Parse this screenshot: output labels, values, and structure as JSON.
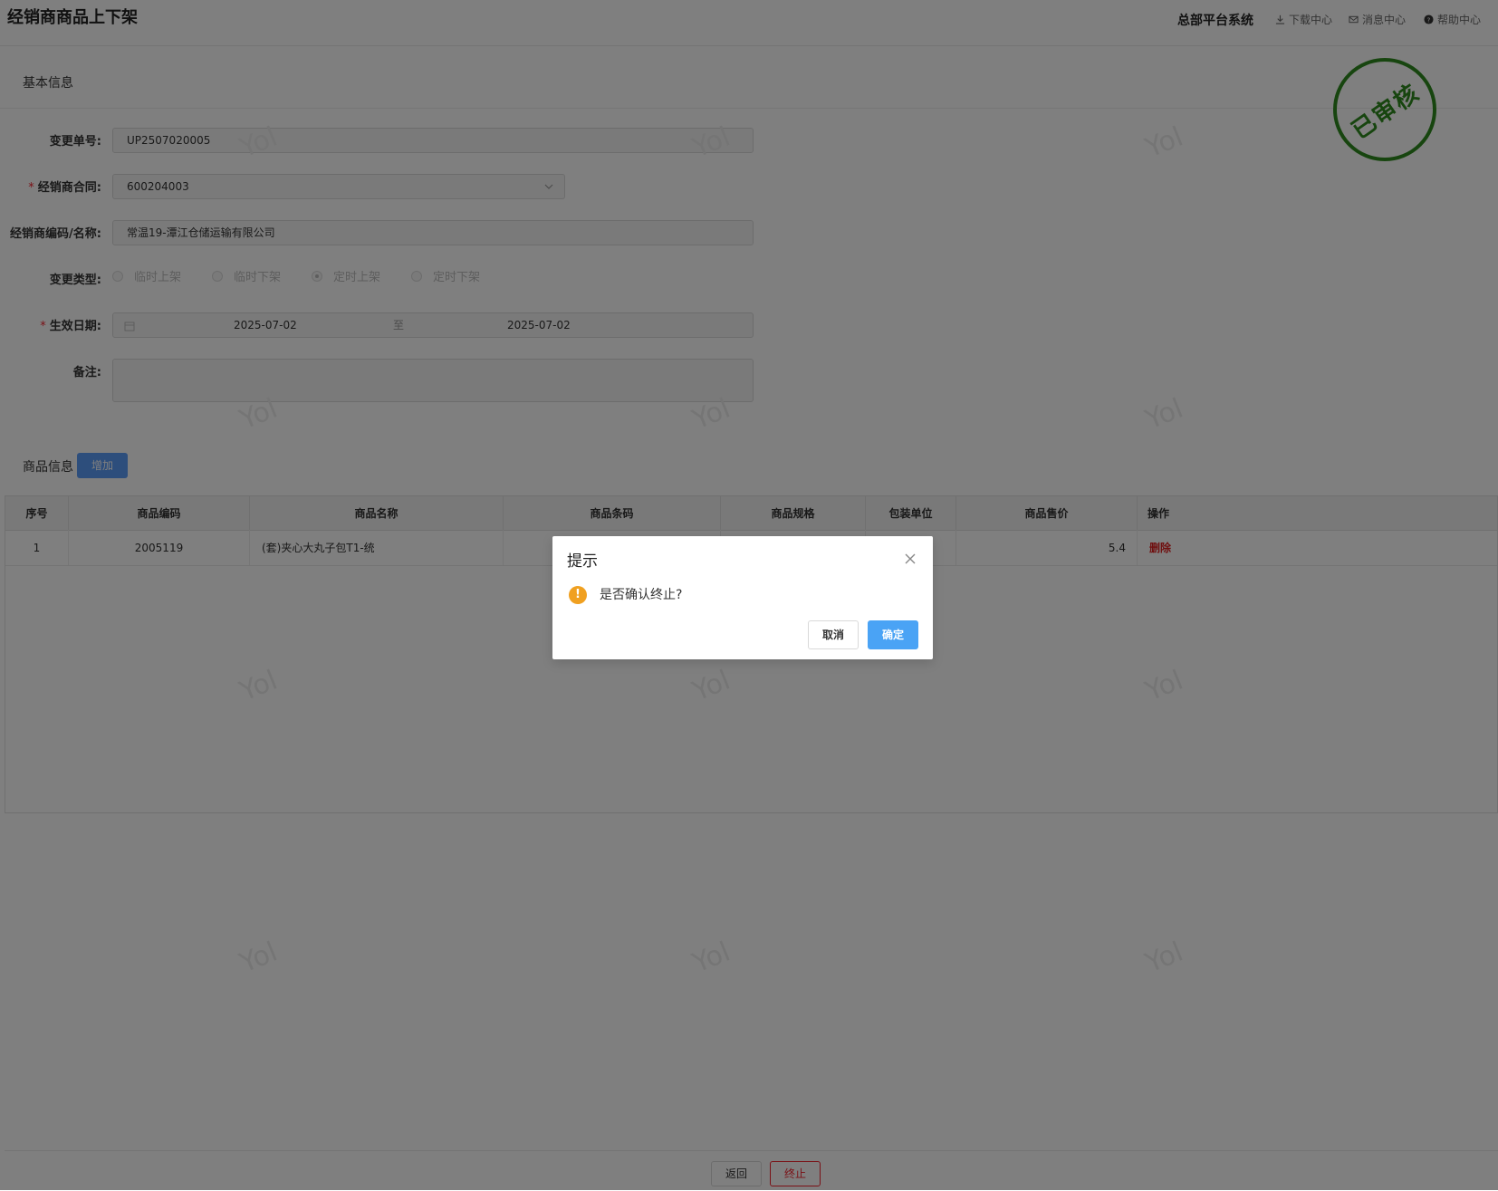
{
  "header": {
    "title": "经销商商品上下架",
    "system_name": "总部平台系统",
    "links": [
      "下载中心",
      "消息中心",
      "帮助中心"
    ]
  },
  "basic": {
    "section_title": "基本信息",
    "stamp": "已审核",
    "change_no_label": "变更单号:",
    "change_no": "UP2507020005",
    "contract_label": "经销商合同:",
    "contract": "600204003",
    "dealer_label": "经销商编码/名称:",
    "dealer": "常温19-潭江仓储运输有限公司",
    "type_label": "变更类型:",
    "type_options": [
      "临时上架",
      "临时下架",
      "定时上架",
      "定时下架"
    ],
    "type_selected": "定时上架",
    "date_label": "生效日期:",
    "date_start": "2025-07-02",
    "date_sep": "至",
    "date_end": "2025-07-02",
    "remark_label": "备注:",
    "remark": ""
  },
  "goods": {
    "section_title": "商品信息",
    "add_label": "增加",
    "columns": [
      "序号",
      "商品编码",
      "商品名称",
      "商品条码",
      "商品规格",
      "包装单位",
      "商品售价",
      "操作"
    ],
    "rows": [
      {
        "idx": "1",
        "code": "2005119",
        "name": "(套)夹心大丸子包T1-统",
        "barcode": "",
        "spec": "",
        "unit": "",
        "price": "5.4",
        "action": "删除"
      }
    ]
  },
  "watermark": "Yol",
  "footer": {
    "back_label": "返回",
    "stop_label": "终止"
  },
  "dialog": {
    "title": "提示",
    "message": "是否确认终止?",
    "warn_symbol": "!",
    "cancel_label": "取消",
    "ok_label": "确定"
  }
}
